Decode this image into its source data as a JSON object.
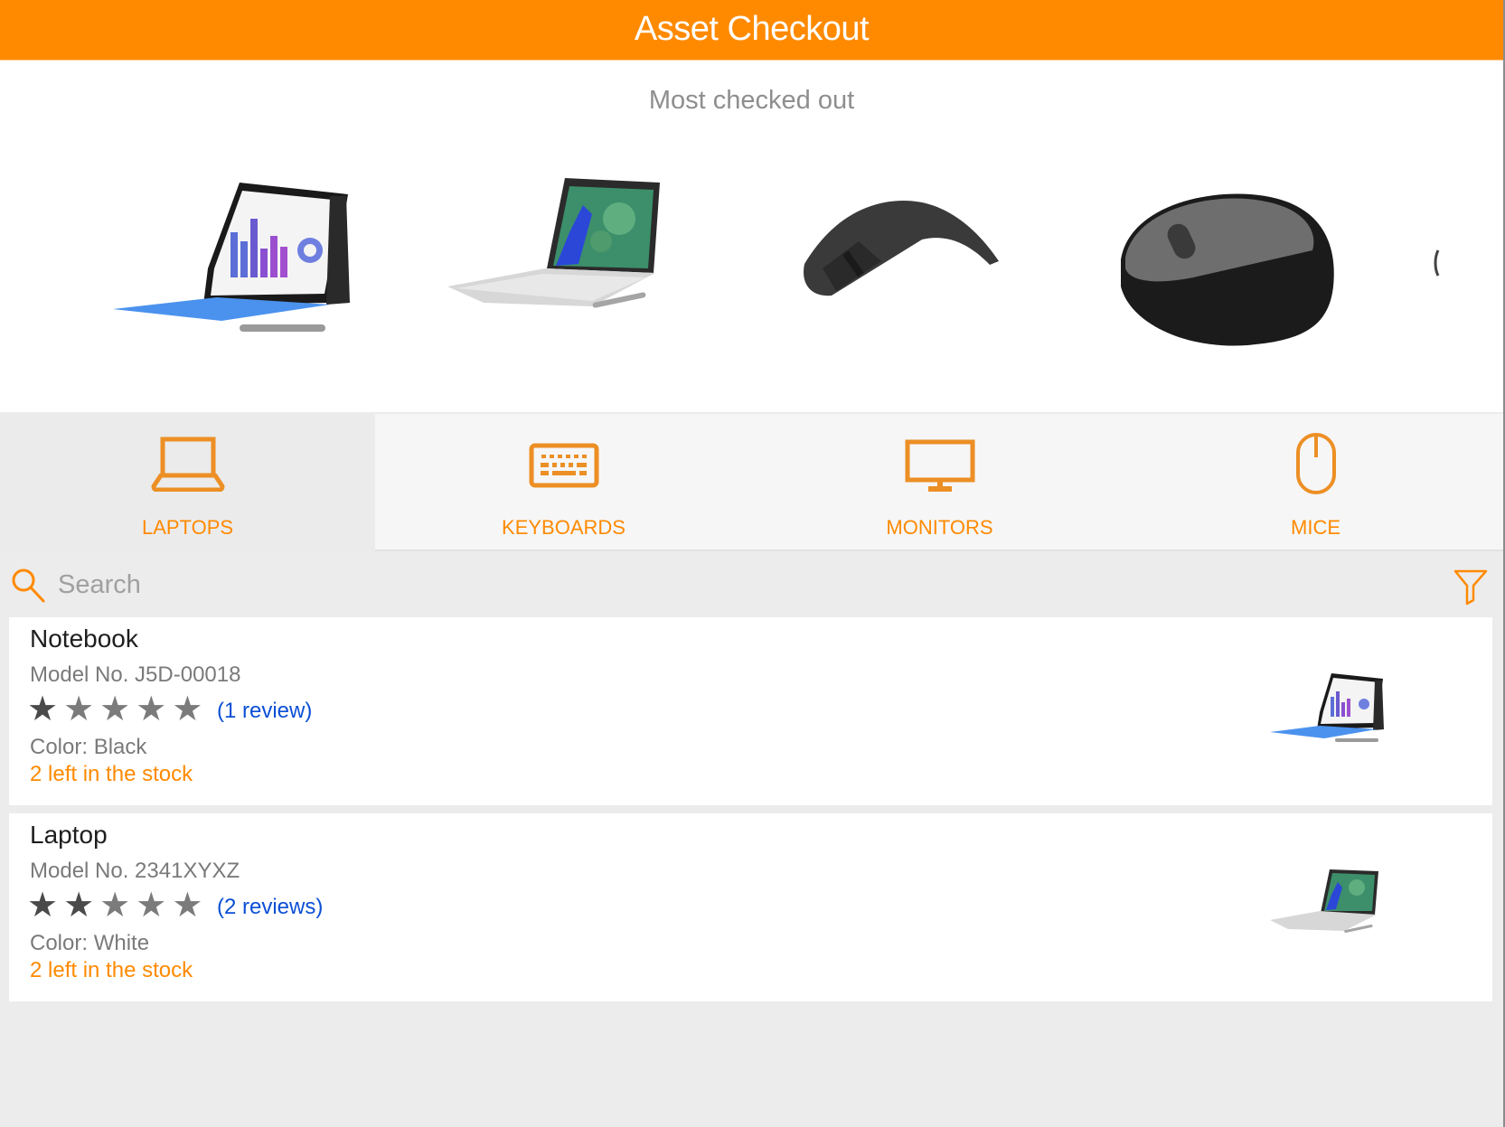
{
  "header": {
    "title": "Asset Checkout"
  },
  "hero": {
    "title": "Most checked out",
    "items": [
      {
        "name": "Surface Pro tablet with blue keyboard",
        "kind": "tablet"
      },
      {
        "name": "Surface Book laptop",
        "kind": "laptop"
      },
      {
        "name": "Arc Touch mouse",
        "kind": "arc-mouse"
      },
      {
        "name": "Wireless mobile mouse",
        "kind": "mouse"
      }
    ]
  },
  "tabs": [
    {
      "label": "LAPTOPS",
      "icon": "laptop-icon",
      "active": true
    },
    {
      "label": "KEYBOARDS",
      "icon": "keyboard-icon",
      "active": false
    },
    {
      "label": "MONITORS",
      "icon": "monitor-icon",
      "active": false
    },
    {
      "label": "MICE",
      "icon": "mouse-icon",
      "active": false
    }
  ],
  "search": {
    "placeholder": "Search",
    "value": ""
  },
  "colors": {
    "accent": "#ff8a00",
    "link": "#0b4fd6"
  },
  "products": [
    {
      "name": "Notebook",
      "model": "Model No. J5D-00018",
      "rating": 1,
      "max_rating": 5,
      "reviews": "(1 review)",
      "color": "Color: Black",
      "stock": "2 left in the stock",
      "thumb": "tablet"
    },
    {
      "name": "Laptop",
      "model": "Model No. 2341XYXZ",
      "rating": 2,
      "max_rating": 5,
      "reviews": "(2 reviews)",
      "color": "Color: White",
      "stock": "2 left in the stock",
      "thumb": "laptop"
    }
  ]
}
